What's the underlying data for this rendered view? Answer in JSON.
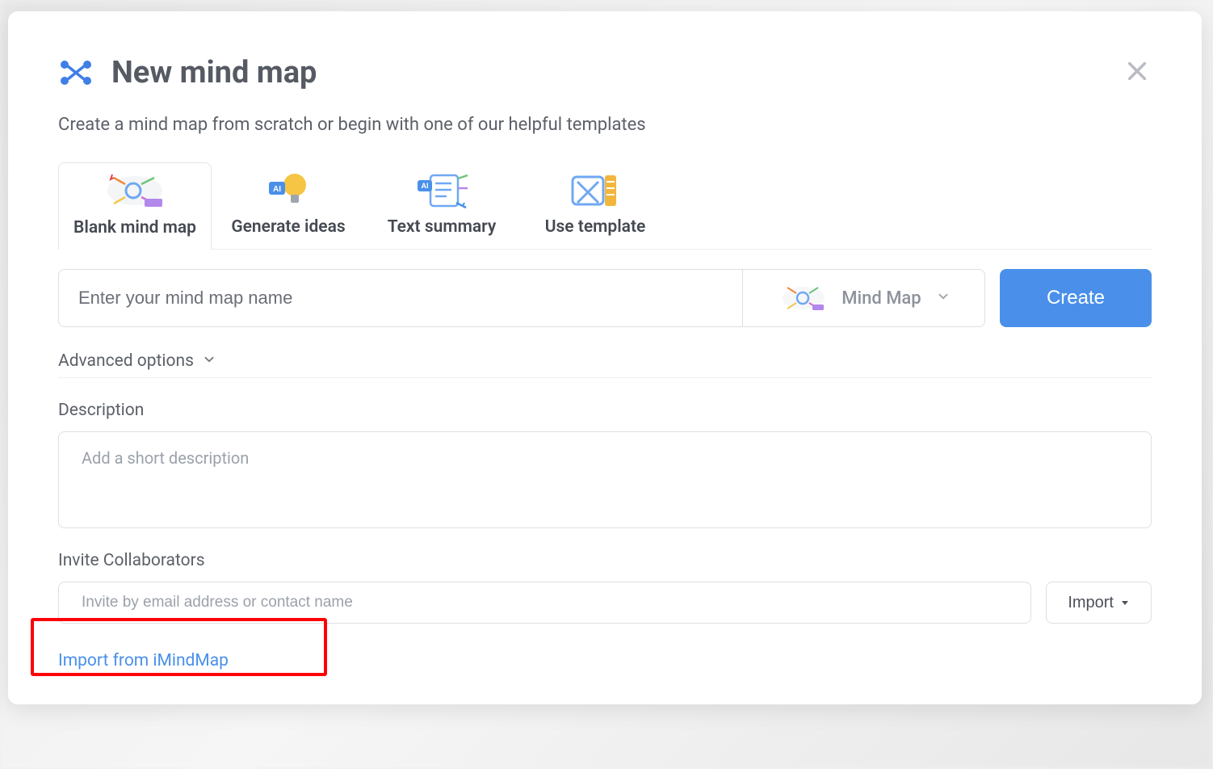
{
  "dialog": {
    "title": "New mind map",
    "subtitle": "Create a mind map from scratch or begin with one of our helpful templates"
  },
  "tabs": [
    {
      "label": "Blank mind map",
      "active": true
    },
    {
      "label": "Generate ideas",
      "active": false
    },
    {
      "label": "Text summary",
      "active": false
    },
    {
      "label": "Use template",
      "active": false
    }
  ],
  "form": {
    "name_placeholder": "Enter your mind map name",
    "type_label": "Mind Map",
    "create_label": "Create",
    "advanced_label": "Advanced options",
    "description_label": "Description",
    "description_placeholder": "Add a short description",
    "collaborators_label": "Invite Collaborators",
    "collaborators_placeholder": "Invite by email address or contact name",
    "import_button_label": "Import",
    "import_link_label": "Import from iMindMap"
  },
  "colors": {
    "primary": "#4a90ea",
    "highlight": "#ff0008"
  }
}
